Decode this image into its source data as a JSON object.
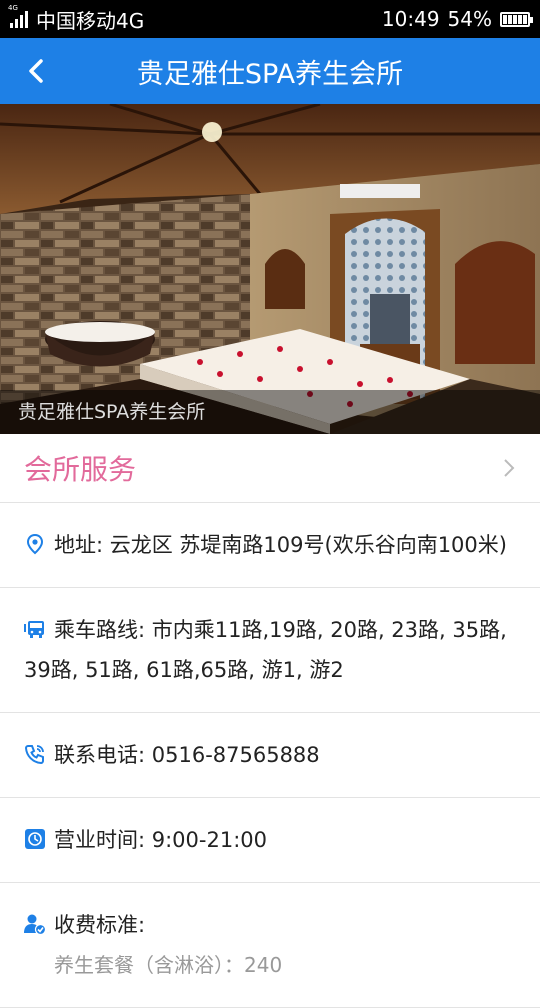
{
  "status_bar": {
    "carrier": "中国移动4G",
    "network_tag": "4G",
    "time": "10:49",
    "battery": "54%"
  },
  "header": {
    "title": "贵足雅仕SPA养生会所"
  },
  "hero": {
    "caption": "贵足雅仕SPA养生会所"
  },
  "service": {
    "label": "会所服务"
  },
  "info": {
    "address": "地址: 云龙区 苏堤南路109号(欢乐谷向南100米)",
    "route": "乘车路线: 市内乘11路,19路, 20路, 23路, 35路, 39路, 51路, 61路,65路, 游1, 游2",
    "phone": "联系电话: 0516-87565888",
    "hours": "营业时间: 9:00-21:00",
    "price_label": "收费标准:",
    "price_item": "养生套餐（含淋浴）：240"
  },
  "colors": {
    "accent": "#1e80e6",
    "service": "#e26a9b"
  },
  "icons": [
    "back-arrow-icon",
    "chevron-right-icon",
    "location-pin-icon",
    "bus-icon",
    "phone-icon",
    "clock-icon",
    "user-check-icon"
  ]
}
